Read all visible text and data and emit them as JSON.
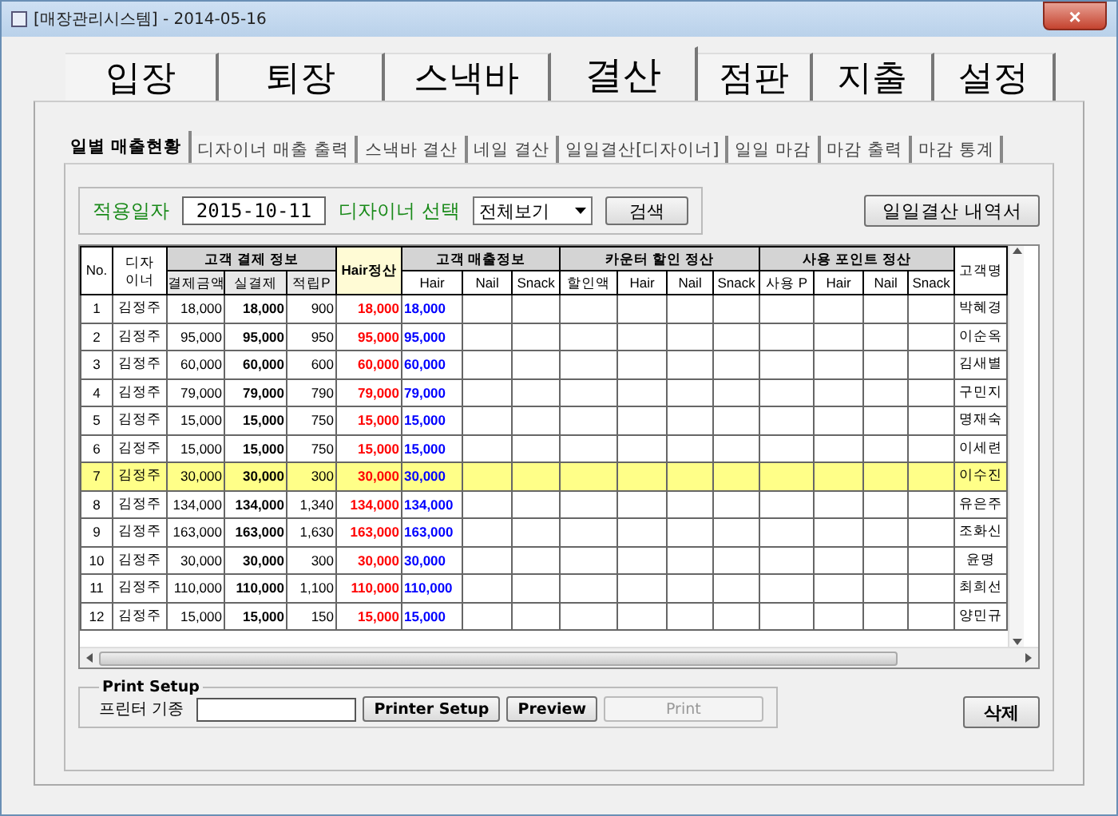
{
  "window": {
    "title": "[매장관리시스템] - 2014-05-16",
    "close": "×"
  },
  "main_tabs": [
    {
      "label": "입장",
      "selected": false
    },
    {
      "label": "퇴장",
      "selected": false
    },
    {
      "label": "스낵바",
      "selected": false
    },
    {
      "label": "결산",
      "selected": true
    },
    {
      "label": "점판",
      "selected": false
    },
    {
      "label": "지출",
      "selected": false
    },
    {
      "label": "설정",
      "selected": false
    }
  ],
  "sub_tabs": [
    {
      "label": "일별 매출현황",
      "selected": true
    },
    {
      "label": "디자이너 매출 출력",
      "selected": false
    },
    {
      "label": "스낵바 결산",
      "selected": false
    },
    {
      "label": "네일 결산",
      "selected": false
    },
    {
      "label": "일일결산[디자이너]",
      "selected": false
    },
    {
      "label": "일일 마감",
      "selected": false
    },
    {
      "label": "마감 출력",
      "selected": false
    },
    {
      "label": "마감 통계",
      "selected": false
    }
  ],
  "filter": {
    "date_label": "적용일자",
    "date": "2015-10-11",
    "designer_label": "디자이너 선택",
    "designer": "전체보기",
    "search_button": "검색",
    "report_button": "일일결산 내역서"
  },
  "table": {
    "groups": [
      "No.",
      "디자\n이너",
      "고객 결제 정보",
      "Hair정산",
      "고객 매출정보",
      "카운터 할인 정산",
      "사용 포인트 정산",
      "고객명"
    ],
    "columns": [
      "결제금액",
      "실결제",
      "적립P",
      "Hair",
      "Nail",
      "Snack",
      "할인액",
      "Hair",
      "Nail",
      "Snack",
      "사용 P",
      "Hair",
      "Nail",
      "Snack"
    ],
    "rows": [
      {
        "no": "1",
        "designer": "김정주",
        "amount": "18,000",
        "paid": "18,000",
        "points": "900",
        "hair_settle": "18,000",
        "hair": "18,000",
        "customer": "박혜경",
        "selected": false
      },
      {
        "no": "2",
        "designer": "김정주",
        "amount": "95,000",
        "paid": "95,000",
        "points": "950",
        "hair_settle": "95,000",
        "hair": "95,000",
        "customer": "이순옥",
        "selected": false
      },
      {
        "no": "3",
        "designer": "김정주",
        "amount": "60,000",
        "paid": "60,000",
        "points": "600",
        "hair_settle": "60,000",
        "hair": "60,000",
        "customer": "김새별",
        "selected": false
      },
      {
        "no": "4",
        "designer": "김정주",
        "amount": "79,000",
        "paid": "79,000",
        "points": "790",
        "hair_settle": "79,000",
        "hair": "79,000",
        "customer": "구민지",
        "selected": false
      },
      {
        "no": "5",
        "designer": "김정주",
        "amount": "15,000",
        "paid": "15,000",
        "points": "750",
        "hair_settle": "15,000",
        "hair": "15,000",
        "customer": "명재숙",
        "selected": false
      },
      {
        "no": "6",
        "designer": "김정주",
        "amount": "15,000",
        "paid": "15,000",
        "points": "750",
        "hair_settle": "15,000",
        "hair": "15,000",
        "customer": "이세련",
        "selected": false
      },
      {
        "no": "7",
        "designer": "김정주",
        "amount": "30,000",
        "paid": "30,000",
        "points": "300",
        "hair_settle": "30,000",
        "hair": "30,000",
        "customer": "이수진",
        "selected": true
      },
      {
        "no": "8",
        "designer": "김정주",
        "amount": "134,000",
        "paid": "134,000",
        "points": "1,340",
        "hair_settle": "134,000",
        "hair": "134,000",
        "customer": "유은주",
        "selected": false
      },
      {
        "no": "9",
        "designer": "김정주",
        "amount": "163,000",
        "paid": "163,000",
        "points": "1,630",
        "hair_settle": "163,000",
        "hair": "163,000",
        "customer": "조화신",
        "selected": false
      },
      {
        "no": "10",
        "designer": "김정주",
        "amount": "30,000",
        "paid": "30,000",
        "points": "300",
        "hair_settle": "30,000",
        "hair": "30,000",
        "customer": "윤명",
        "selected": false
      },
      {
        "no": "11",
        "designer": "김정주",
        "amount": "110,000",
        "paid": "110,000",
        "points": "1,100",
        "hair_settle": "110,000",
        "hair": "110,000",
        "customer": "최희선",
        "selected": false
      },
      {
        "no": "12",
        "designer": "김정주",
        "amount": "15,000",
        "paid": "15,000",
        "points": "150",
        "hair_settle": "15,000",
        "hair": "15,000",
        "customer": "양민규",
        "selected": false
      }
    ]
  },
  "print_setup": {
    "title": "Print Setup",
    "printer_label": "프린터 기종",
    "buttons": [
      {
        "label": "Printer Setup",
        "disabled": false
      },
      {
        "label": "Preview",
        "disabled": false
      },
      {
        "label": "Print",
        "disabled": true
      }
    ]
  },
  "delete_button": "삭제"
}
